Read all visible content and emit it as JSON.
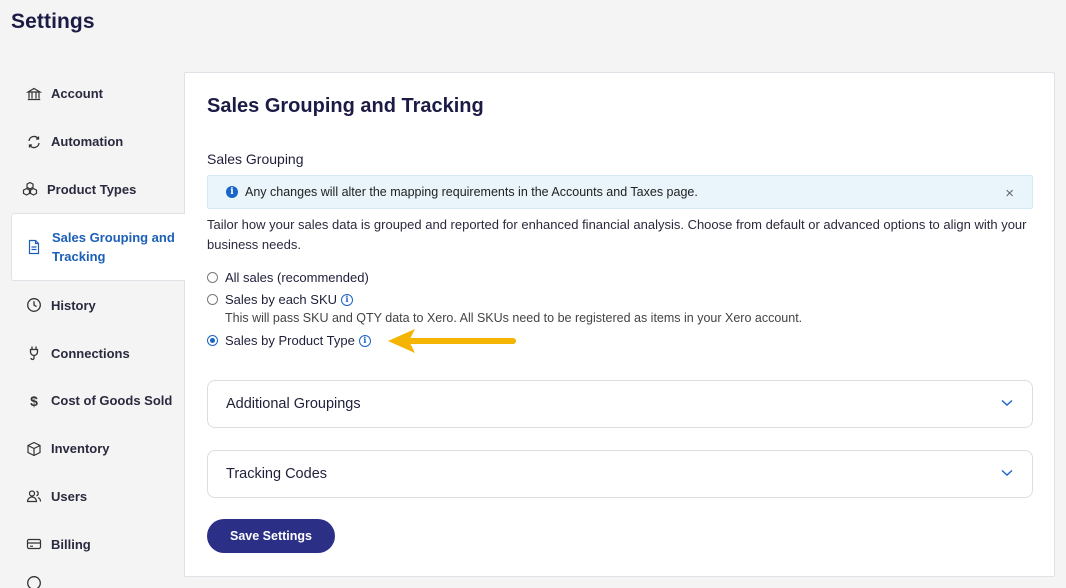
{
  "page": {
    "title": "Settings"
  },
  "sidebar": {
    "items": [
      {
        "label": "Account",
        "icon": "bank-icon"
      },
      {
        "label": "Automation",
        "icon": "sync-icon"
      },
      {
        "label": "Product Types",
        "icon": "cubes-icon"
      },
      {
        "label": "Sales Grouping and Tracking",
        "icon": "document-icon",
        "active": true
      },
      {
        "label": "History",
        "icon": "clock-icon"
      },
      {
        "label": "Connections",
        "icon": "plug-icon"
      },
      {
        "label": "Cost of Goods Sold",
        "icon": "dollar-icon"
      },
      {
        "label": "Inventory",
        "icon": "box-icon"
      },
      {
        "label": "Users",
        "icon": "users-icon"
      },
      {
        "label": "Billing",
        "icon": "credit-card-icon"
      }
    ]
  },
  "main": {
    "title": "Sales Grouping and Tracking",
    "section_label": "Sales Grouping",
    "alert": "Any changes will alter the mapping requirements in the Accounts and Taxes page.",
    "alert_close": "×",
    "description": "Tailor how your sales data is grouped and reported for enhanced financial analysis. Choose from default or advanced options to align with your business needs.",
    "options": [
      {
        "label": "All sales (recommended)",
        "checked": false
      },
      {
        "label": "Sales by each SKU",
        "checked": false,
        "info": true,
        "note": "This will pass SKU and QTY data to Xero. All SKUs need to be registered as items in your Xero account."
      },
      {
        "label": "Sales by Product Type",
        "checked": true,
        "info": true
      }
    ],
    "accordions": [
      {
        "label": "Additional Groupings"
      },
      {
        "label": "Tracking Codes"
      }
    ],
    "save_label": "Save Settings"
  },
  "colors": {
    "accent": "#1a64c8",
    "button": "#2b2f86",
    "arrow": "#f5b400",
    "alert_bg": "#e9f4fb"
  }
}
